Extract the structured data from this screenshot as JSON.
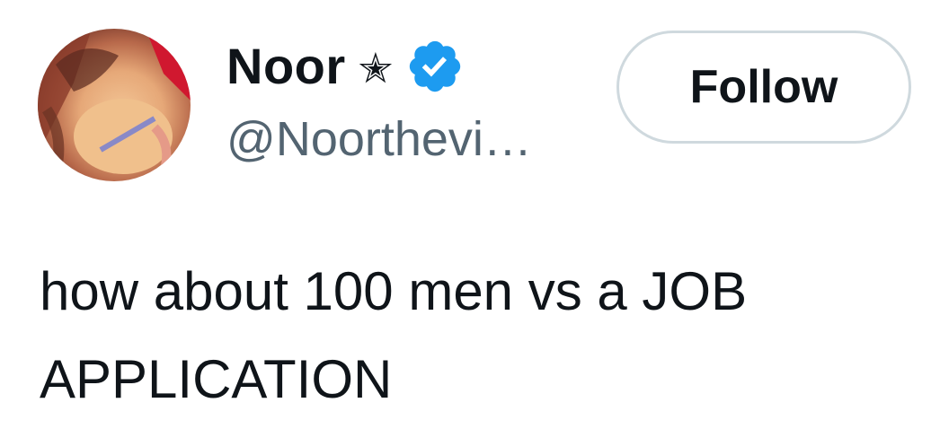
{
  "author": {
    "display_name": "Noor",
    "name_badge_icon": "star-icon",
    "verified_icon": "verified-badge-icon",
    "verified_color": "#1d9bf0",
    "handle": "@Noorthevi…"
  },
  "actions": {
    "follow_label": "Follow"
  },
  "tweet": {
    "text": "how about 100 men vs a JOB\nAPPLICATION"
  }
}
